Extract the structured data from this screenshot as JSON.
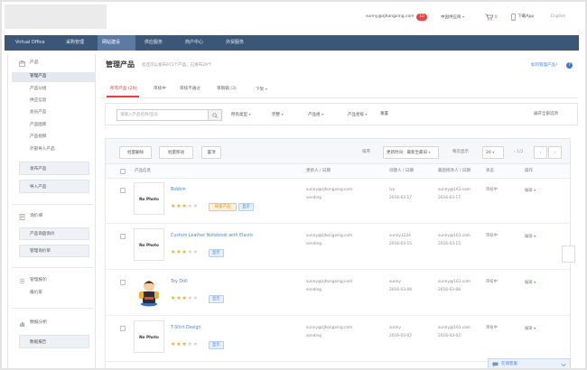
{
  "header": {
    "user": "sunny@zjhongxing.com",
    "notice_count": "10",
    "supplier_menu": "中国供应商",
    "cart_count": "0",
    "app_label": "下载App",
    "language": "English"
  },
  "nav": [
    {
      "label": "Virtual Office"
    },
    {
      "label": "采购管理"
    },
    {
      "label": "网站建设"
    },
    {
      "label": "供应服务"
    },
    {
      "label": "商户中心"
    },
    {
      "label": "外贸服务"
    }
  ],
  "sidebar": {
    "product": {
      "title": "产品",
      "items": [
        "管理产品",
        "产品分组",
        "供应信息",
        "会员产品",
        "产品图库",
        "产品视频",
        "外部导入产品"
      ],
      "buttons": [
        "发布产品",
        "导入产品"
      ]
    },
    "inquiry": {
      "title": "询价单",
      "buttons": [
        "产品询盘询价",
        "管理询价单"
      ]
    },
    "quote": {
      "title": "管理报价",
      "items": [
        "报价单"
      ]
    },
    "stats": {
      "title": "数据分析",
      "buttons": [
        "数据报告"
      ]
    }
  },
  "page": {
    "title": "管理产品",
    "subtitle": "您还可以发布971个产品，已发布29个",
    "help": "如何管理产品?",
    "help_glyph": "?"
  },
  "tabs": [
    "所有产品 (29)",
    "审核中",
    "审核不通过",
    "草稿箱 (3)",
    "下架"
  ],
  "filters": {
    "search_placeholder": "请输入产品名称/型号",
    "type": "所有类型",
    "completeness": "完整",
    "group": "产品组",
    "star": "产品星级",
    "reset": "重置",
    "more": "展开全部选项"
  },
  "toolbar": {
    "delete": "批量删除",
    "move": "批量移动",
    "top": "置顶",
    "sort_label": "排序",
    "sort_value": "更新时间：最新至最旧",
    "page_size_label": "每页显示",
    "page_size": "20",
    "page_info": "1/2"
  },
  "table": {
    "columns": [
      "产品信息",
      "更新人 / 日期",
      "创建人 / 日期",
      "最后修改人 / 日期",
      "状态",
      "操作"
    ]
  },
  "products": [
    {
      "name": "Bobbin",
      "thumb_text": "No Photo",
      "rating": 3,
      "badges": [
        {
          "text": "橱窗产品",
          "tone": "orange"
        },
        {
          "text": "显示",
          "tone": "blue"
        }
      ],
      "updated_by": "sunny@zjhongxing.com",
      "updated_note": "sending",
      "created_by": "ivy",
      "created_date": "2016-03-17",
      "modified_by": "sunny@163.com",
      "modified_date": "2016-03-17",
      "status": "审核中",
      "action": "编辑"
    },
    {
      "name": "Custom Leather Notebook with Elastic",
      "thumb_text": "No Photo",
      "rating": 3,
      "badges": [
        {
          "text": "显示",
          "tone": "blue"
        }
      ],
      "updated_by": "sunny@zjhongxing.com",
      "updated_note": "sending",
      "created_by": "sunny1234",
      "created_date": "2016-03-15",
      "modified_by": "sunny@163.com",
      "modified_date": "2016-03-15",
      "status": "审核中",
      "action": "编辑"
    },
    {
      "name": "Toy Doll",
      "rating": 3,
      "badges": [
        {
          "text": "显示",
          "tone": "blue"
        }
      ],
      "updated_by": "sunny@zjhongxing.com",
      "updated_note": "sending",
      "created_by": "sunny",
      "created_date": "2016-03-08",
      "modified_by": "sunny@163.com",
      "modified_date": "2016-03-08",
      "status": "审核中",
      "action": "编辑"
    },
    {
      "name": "T-Shirt Design",
      "thumb_text": "No Photo",
      "rating": 3,
      "badges": [
        {
          "text": "显示",
          "tone": "blue"
        }
      ],
      "updated_by": "sunny@zjhongxing.com",
      "updated_note": "sending",
      "created_by": "sunny",
      "created_date": "2016-03-02",
      "modified_by": "sunny@163.com",
      "modified_date": "2016-03-02",
      "status": "审核中",
      "action": "编辑"
    }
  ],
  "chat": {
    "label": "在线客服"
  }
}
